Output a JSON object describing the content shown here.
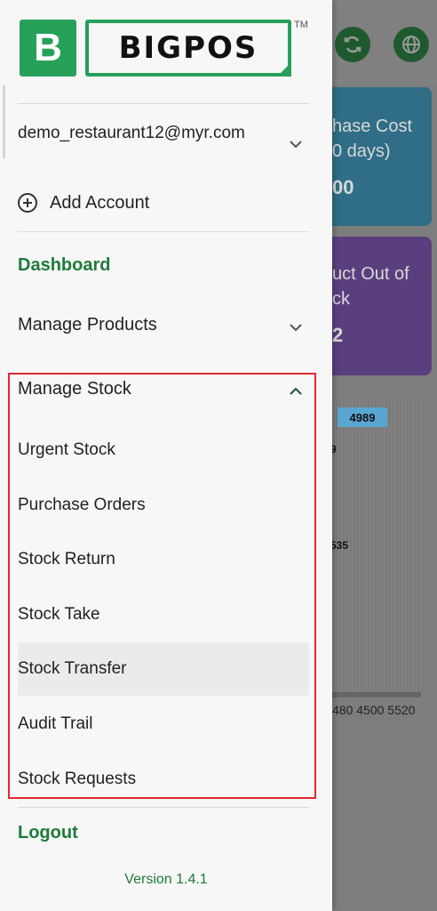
{
  "app": {
    "logo_letter": "B",
    "logo_text": "BIGPOS",
    "trademark": "TM",
    "version": "Version 1.4.1"
  },
  "account": {
    "email": "demo_restaurant12@myr.com",
    "add_account_label": "Add Account"
  },
  "menu": {
    "dashboard": "Dashboard",
    "manage_products": "Manage Products",
    "manage_stock": "Manage Stock",
    "stock_items": [
      {
        "label": "Urgent Stock"
      },
      {
        "label": "Purchase Orders"
      },
      {
        "label": "Stock Return"
      },
      {
        "label": "Stock Take"
      },
      {
        "label": "Stock Transfer"
      },
      {
        "label": "Audit Trail"
      },
      {
        "label": "Stock Requests"
      }
    ],
    "logout": "Logout"
  },
  "background": {
    "card1_line1": "hase Cost",
    "card1_line2": "0 days)",
    "card1_value": "00",
    "card2_line1": "uct Out of",
    "card2_line2": "ck",
    "card2_value": "2",
    "chart_tag": "4989",
    "chart_label_1": "9",
    "chart_label_2": "535",
    "axis_labels": "480 4500 5520"
  },
  "colors": {
    "brand_green": "#27a05a",
    "menu_green": "#1f7a3a",
    "highlight_red": "#e0282e"
  }
}
